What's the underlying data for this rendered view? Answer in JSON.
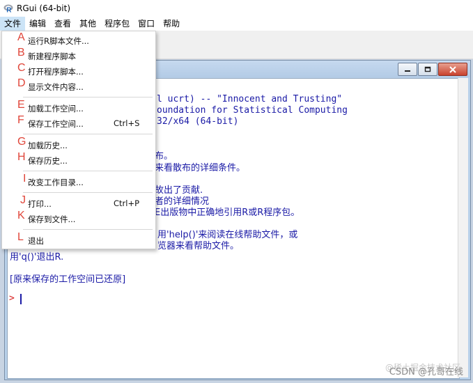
{
  "app": {
    "title": "RGui (64-bit)"
  },
  "menubar": [
    "文件",
    "编辑",
    "查看",
    "其他",
    "程序包",
    "窗口",
    "帮助"
  ],
  "file_menu": {
    "items": [
      {
        "letter": "A",
        "label": "运行R脚本文件...",
        "shortcut": ""
      },
      {
        "letter": "B",
        "label": "新建程序脚本",
        "shortcut": ""
      },
      {
        "letter": "C",
        "label": "打开程序脚本...",
        "shortcut": ""
      },
      {
        "letter": "D",
        "label": "显示文件内容...",
        "shortcut": ""
      },
      {
        "letter": "E",
        "label": "加载工作空间...",
        "shortcut": ""
      },
      {
        "letter": "F",
        "label": "保存工作空间...",
        "shortcut": "Ctrl+S"
      },
      {
        "letter": "G",
        "label": "加载历史...",
        "shortcut": ""
      },
      {
        "letter": "H",
        "label": "保存历史...",
        "shortcut": ""
      },
      {
        "letter": "I",
        "label": "改变工作目录...",
        "shortcut": ""
      },
      {
        "letter": "J",
        "label": "打印...",
        "shortcut": "Ctrl+P"
      },
      {
        "letter": "K",
        "label": "保存到文件...",
        "shortcut": ""
      },
      {
        "letter": "L",
        "label": "退出",
        "shortcut": ""
      }
    ]
  },
  "console": {
    "lines": [
      "l ucrt) -- \"Innocent and Trusting\"",
      "oundation for Statistical Computing",
      "32/x64 (64-bit)",
      "布。",
      "来看散布的详细条件。",
      "故出了贡献.",
      "者的详细情况",
      "E出版物中正确地引用R或R程序包。",
      "用'help()'来阅读在线帮助文件，或",
      "览器来看帮助文件。",
      "用'q()'退出R.",
      "[原来保存的工作空间已还原]"
    ],
    "prompt": ">"
  },
  "watermark": "CSDN @孔哥在线",
  "watermark_faint": "@稀土掘金技术社区"
}
